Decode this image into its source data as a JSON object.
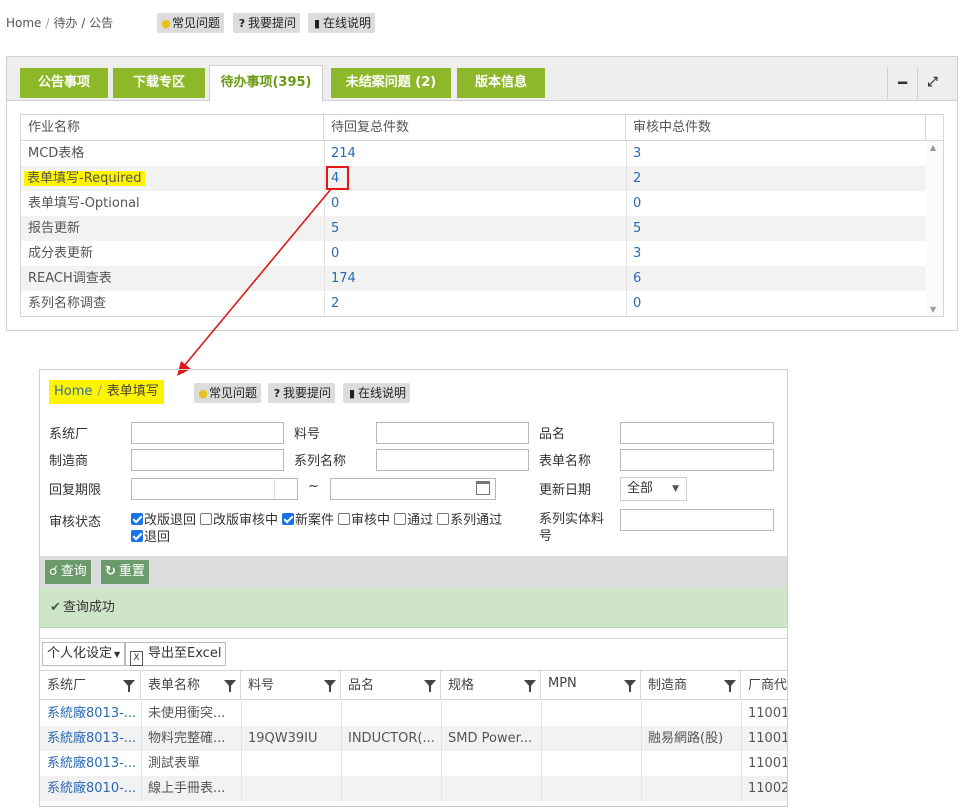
{
  "top": {
    "breadcrumb": {
      "home": "Home",
      "sep": "/",
      "current": "待办 / 公告"
    },
    "help": {
      "faq": "常见问题",
      "ask": "我要提问",
      "online": "在线说明"
    }
  },
  "panel1": {
    "tabs": [
      {
        "label": "公告事项"
      },
      {
        "label": "下载专区"
      },
      {
        "label": "待办事项(395)"
      },
      {
        "label": "未结案问题 (2)"
      },
      {
        "label": "版本信息"
      }
    ],
    "tools": {
      "minimize": "━",
      "expand": "⤢"
    },
    "grid": {
      "columns": [
        "作业名称",
        "待回复总件数",
        "审核中总件数"
      ],
      "rows": [
        {
          "name": "MCD表格",
          "pending": "214",
          "review": "3"
        },
        {
          "name": "表单填写-Required",
          "pending": "4",
          "review": "2"
        },
        {
          "name": "表单填写-Optional",
          "pending": "0",
          "review": "0"
        },
        {
          "name": "报告更新",
          "pending": "5",
          "review": "5"
        },
        {
          "name": "成分表更新",
          "pending": "0",
          "review": "3"
        },
        {
          "name": "REACH调查表",
          "pending": "174",
          "review": "6"
        },
        {
          "name": "系列名称调查",
          "pending": "2",
          "review": "0"
        }
      ]
    }
  },
  "panel2": {
    "breadcrumb": {
      "home": "Home",
      "sep": "/",
      "current": "表单填写"
    },
    "help": {
      "faq": "常见问题",
      "ask": "我要提问",
      "online": "在线说明"
    },
    "form": {
      "system_factory": "系统厂",
      "part_no": "料号",
      "product_name": "品名",
      "manufacturer": "制造商",
      "series_name": "系列名称",
      "form_name": "表单名称",
      "reply_deadline": "回复期限",
      "range_sep": "~",
      "update_date": "更新日期",
      "update_date_value": "全部",
      "review_status": "审核状态",
      "series_part": "系列实体料号",
      "statuses": [
        {
          "label": "改版退回",
          "checked": true
        },
        {
          "label": "改版审核中",
          "checked": false
        },
        {
          "label": "新案件",
          "checked": true
        },
        {
          "label": "审核中",
          "checked": false
        },
        {
          "label": "通过",
          "checked": false
        },
        {
          "label": "系列通过",
          "checked": false
        },
        {
          "label": "退回",
          "checked": true
        }
      ]
    },
    "buttons": {
      "query": "查询",
      "reset": "重置"
    },
    "success": "查询成功",
    "tools": {
      "personalize": "个人化设定",
      "export": "导出至Excel"
    },
    "grid": {
      "columns": [
        "系统厂",
        "表单名称",
        "料号",
        "品名",
        "规格",
        "MPN",
        "制造商",
        "厂商代"
      ],
      "rows": [
        [
          "系統廠8013-...",
          "未使用衝突...",
          "",
          "",
          "",
          "",
          "",
          "11001"
        ],
        [
          "系統廠8013-...",
          "物料完整確...",
          "19QW39IU",
          "INDUCTOR(...",
          "SMD Power...",
          "",
          "融易網路(股)",
          "11001"
        ],
        [
          "系統廠8013-...",
          "測試表單",
          "",
          "",
          "",
          "",
          "",
          "11001"
        ],
        [
          "系統廠8010-...",
          "線上手冊表...",
          "",
          "",
          "",
          "",
          "",
          "11002"
        ]
      ]
    }
  }
}
